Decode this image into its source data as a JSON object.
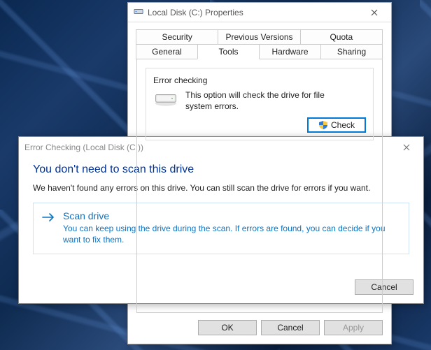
{
  "properties": {
    "title": "Local Disk (C:) Properties",
    "tabs_row1": [
      "Security",
      "Previous Versions",
      "Quota"
    ],
    "tabs_row2": [
      "General",
      "Tools",
      "Hardware",
      "Sharing"
    ],
    "active_tab": "Tools",
    "error_checking": {
      "group_title": "Error checking",
      "description": "This option will check the drive for file system errors.",
      "check_button": "Check"
    },
    "footer": {
      "ok": "OK",
      "cancel": "Cancel",
      "apply": "Apply"
    }
  },
  "error_dialog": {
    "title": "Error Checking (Local Disk (C:))",
    "heading": "You don't need to scan this drive",
    "body": "We haven't found any errors on this drive. You can still scan the drive for errors if you want.",
    "option": {
      "title": "Scan drive",
      "desc": "You can keep using the drive during the scan. If errors are found, you can decide if you want to fix them."
    },
    "cancel": "Cancel"
  }
}
